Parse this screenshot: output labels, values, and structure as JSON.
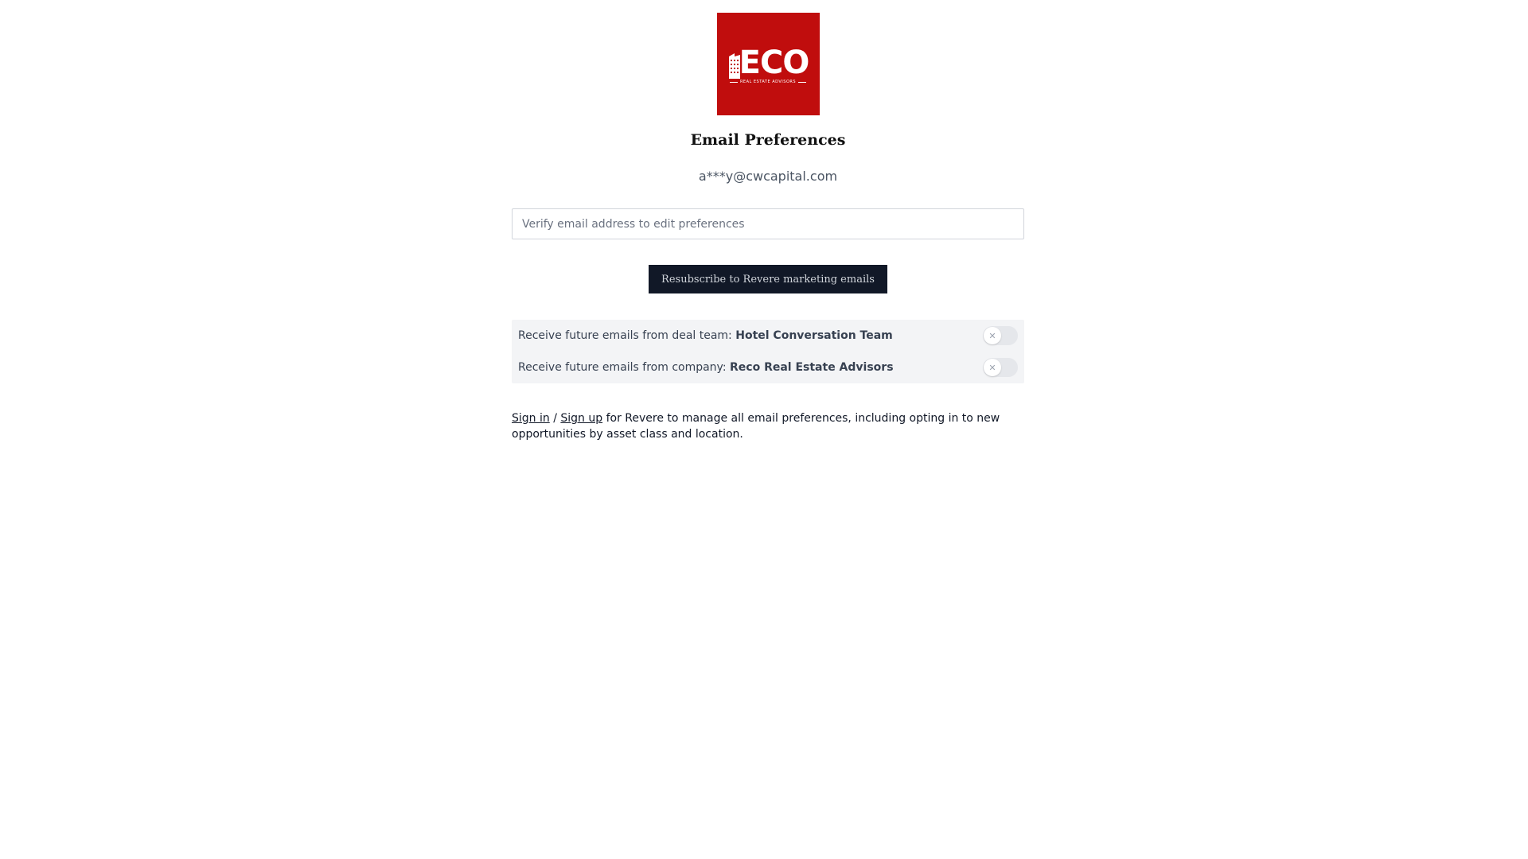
{
  "logo": {
    "word": "ECO",
    "subtitle": "REAL ESTATE ADVISORS",
    "background_color": "#c00d0d"
  },
  "page_title": "Email Preferences",
  "masked_email": "a***y@cwcapital.com",
  "verify_input": {
    "placeholder": "Verify email address to edit preferences",
    "value": ""
  },
  "resubscribe_button": {
    "label": "Resubscribe to Revere marketing emails"
  },
  "preferences": [
    {
      "prefix": "Receive future emails from deal team: ",
      "name": "Hotel Conversation Team",
      "toggle_icon": "x-icon",
      "enabled": false
    },
    {
      "prefix": "Receive future emails from company: ",
      "name": "Reco Real Estate Advisors",
      "toggle_icon": "x-icon",
      "enabled": false
    }
  ],
  "footer": {
    "sign_in": "Sign in",
    "separator": " / ",
    "sign_up": "Sign up",
    "text": " for Revere to manage all email preferences, including opting in to new opportunities by asset class and location."
  },
  "colors": {
    "button_bg": "#111827",
    "pref_bg": "#f3f4f6"
  }
}
